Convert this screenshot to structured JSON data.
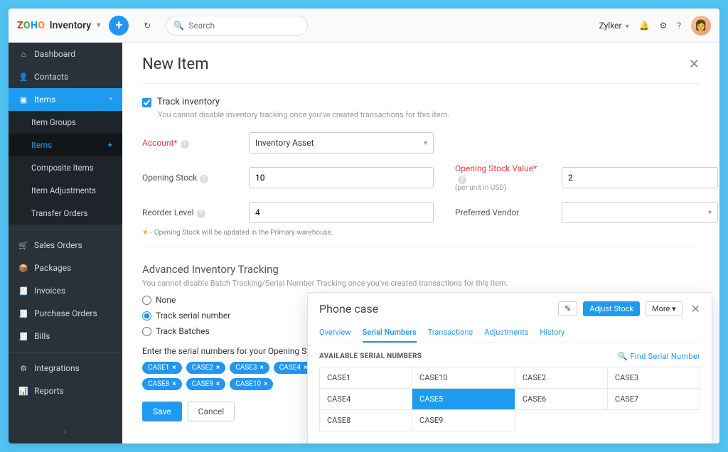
{
  "brand": {
    "product": "Inventory"
  },
  "topbar": {
    "search_placeholder": "Search",
    "org": "Zylker"
  },
  "sidebar": {
    "dashboard": "Dashboard",
    "contacts": "Contacts",
    "items": "Items",
    "item_groups": "Item Groups",
    "items_sub": "Items",
    "composite": "Composite Items",
    "item_adjust": "Item Adjustments",
    "transfer": "Transfer Orders",
    "sales_orders": "Sales Orders",
    "packages": "Packages",
    "invoices": "Invoices",
    "purchase_orders": "Purchase Orders",
    "bills": "Bills",
    "integrations": "Integrations",
    "reports": "Reports"
  },
  "page": {
    "title": "New Item",
    "track_label": "Track inventory",
    "track_note": "You cannot disable inventory tracking once you've created transactions for this item.",
    "account_label": "Account*",
    "account_value": "Inventory Asset",
    "opening_stock_label": "Opening Stock",
    "opening_stock_value": "10",
    "opening_stock_value_label": "Opening Stock Value*",
    "opening_stock_value_note": "(per unit in USD)",
    "opening_stock_value_amt": "2",
    "reorder_label": "Reorder Level",
    "reorder_value": "4",
    "vendor_label": "Preferred Vendor",
    "warn": "- Opening Stock will be updated in the Primary warehouse.",
    "adv_title": "Advanced Inventory Tracking",
    "adv_note": "You cannot disable Batch Tracking/Serial Number Tracking once you've created transactions for this item.",
    "radio_none": "None",
    "radio_serial": "Track serial number",
    "radio_batch": "Track Batches",
    "serial_enter_label": "Enter the serial numbers for your Opening Stock",
    "chips": [
      "CASE1",
      "CASE2",
      "CASE3",
      "CASE4",
      "CASE8",
      "CASE9",
      "CASE10"
    ],
    "save": "Save",
    "cancel": "Cancel"
  },
  "panel": {
    "title": "Phone case",
    "adjust": "Adjust Stock",
    "more": "More",
    "tabs": {
      "overview": "Overview",
      "serials": "Serial Numbers",
      "trans": "Transactions",
      "adjust": "Adjustments",
      "history": "History"
    },
    "available": "AVAILABLE SERIAL NUMBERS",
    "find": "Find Serial Number",
    "rows": [
      [
        "CASE1",
        "CASE10",
        "CASE2",
        "CASE3"
      ],
      [
        "CASE4",
        "CASE5",
        "CASE6",
        "CASE7"
      ],
      [
        "CASE8",
        "CASE9",
        "",
        ""
      ]
    ],
    "selected": "CASE5"
  }
}
